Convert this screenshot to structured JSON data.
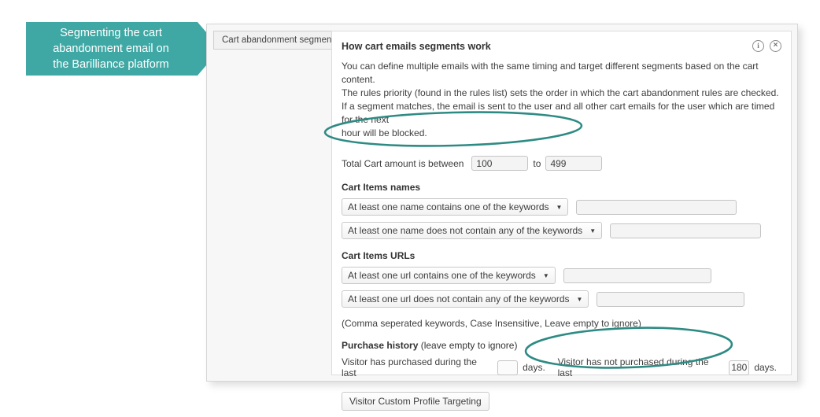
{
  "callout": {
    "text": "Segmenting the cart\nabandonment email on\nthe Barilliance platform",
    "bg_color": "#3fa8a4",
    "text_color": "#ffffff"
  },
  "annotation": {
    "ellipse_color": "#2e8b84",
    "targets": [
      "total-cart-amount-row",
      "visitor-has-not-purchased-row"
    ]
  },
  "panel": {
    "tab": {
      "label": "Cart abandonment segment"
    },
    "card": {
      "title": "How cart emails segments work",
      "icons": {
        "info": "i",
        "close": "×"
      },
      "intro": [
        "You can define multiple emails with the same timing and target different segments based on the cart content.",
        "The rules priority (found in the rules list) sets the order in which the cart abandonment rules are checked.",
        "If a segment matches, the email is sent to the user and all other cart emails for the user which are timed for the next",
        "hour will be blocked."
      ],
      "total_cart": {
        "label_prefix": "Total Cart amount is between",
        "min_value": "100",
        "joiner": "to",
        "max_value": "499",
        "placeholder": ""
      },
      "cart_items_names": {
        "title": "Cart Items names",
        "rules": [
          {
            "select_label": "At least one name contains one of the keywords",
            "value": "",
            "placeholder": ""
          },
          {
            "select_label": "At least one name does not contain any of the keywords",
            "value": "",
            "placeholder": ""
          }
        ]
      },
      "cart_items_urls": {
        "title": "Cart Items URLs",
        "rules": [
          {
            "select_label": "At least one url contains one of the keywords",
            "value": "",
            "placeholder": ""
          },
          {
            "select_label": "At least one url does not contain any of the keywords",
            "value": "",
            "placeholder": ""
          }
        ]
      },
      "keywords_note": "(Comma seperated keywords, Case Insensitive, Leave empty to ignore)",
      "purchase_history": {
        "title": "Purchase history",
        "title_suffix": "(leave empty to ignore)",
        "purchased": {
          "prefix": "Visitor has purchased during the last",
          "value": "",
          "suffix": "days."
        },
        "not_purchased": {
          "prefix": "Visitor has not purchased during the last",
          "value": "180",
          "suffix": "days."
        }
      },
      "custom_profile_button": "Visitor Custom Profile Targeting"
    }
  }
}
